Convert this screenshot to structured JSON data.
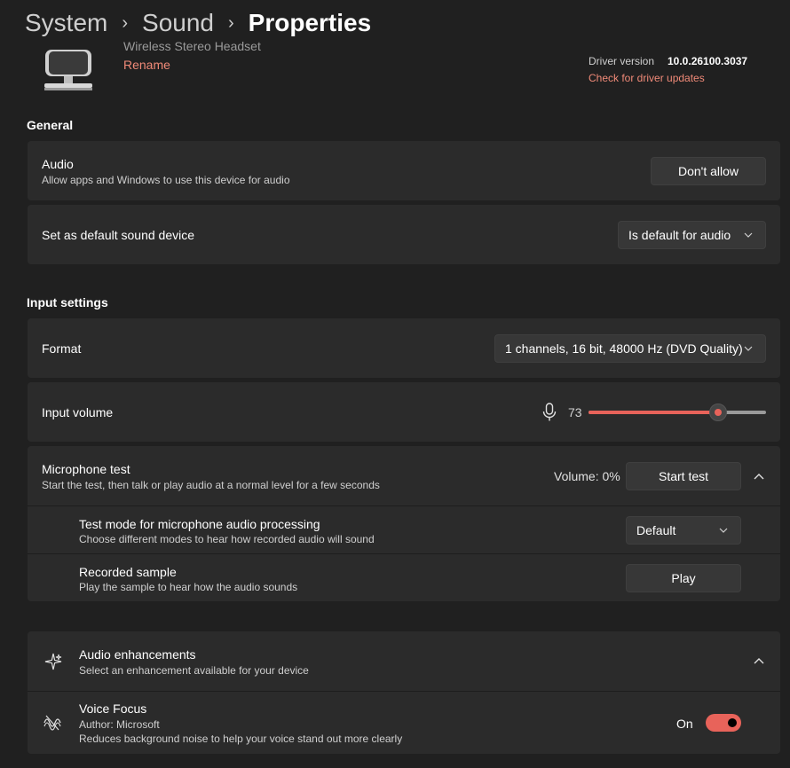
{
  "breadcrumb": {
    "item1": "System",
    "item2": "Sound",
    "current": "Properties",
    "separator": "›"
  },
  "device": {
    "name": "Wireless Stereo Headset",
    "rename_label": "Rename",
    "driver_label": "Driver version",
    "driver_value": "10.0.26100.3037",
    "driver_link": "Check for driver updates"
  },
  "general": {
    "heading": "General",
    "audio": {
      "title": "Audio",
      "description": "Allow apps and Windows to use this device for audio",
      "button": "Don't allow"
    },
    "default": {
      "title": "Set as default sound device",
      "value": "Is default for audio"
    }
  },
  "input": {
    "heading": "Input settings",
    "format": {
      "title": "Format",
      "value": "1 channels, 16 bit, 48000 Hz (DVD Quality)"
    },
    "volume": {
      "title": "Input volume",
      "value": "73",
      "level": 73,
      "max": 100
    },
    "mic_test": {
      "title": "Microphone test",
      "description": "Start the test, then talk or play audio at a normal level for a few seconds",
      "volume_label": "Volume: 0%",
      "button": "Start test"
    },
    "test_mode": {
      "title": "Test mode for microphone audio processing",
      "description": "Choose different modes to hear how recorded audio will sound",
      "value": "Default"
    },
    "recorded": {
      "title": "Recorded sample",
      "description": "Play the sample to hear how the audio sounds",
      "button": "Play"
    }
  },
  "enhancements": {
    "title": "Audio enhancements",
    "description": "Select an enhancement available for your device",
    "voice_focus": {
      "title": "Voice Focus",
      "author": "Author: Microsoft",
      "description": "Reduces background noise to help your voice stand out more clearly",
      "state": "On",
      "enabled": true
    }
  },
  "colors": {
    "accent": "#e8635a",
    "link": "#f08a78",
    "card": "#2b2b2b",
    "background": "#202020"
  },
  "icons": [
    "headset-icon",
    "chevron-down-icon",
    "chevron-up-icon",
    "microphone-icon",
    "sparkle-icon",
    "voice-focus-icon"
  ]
}
